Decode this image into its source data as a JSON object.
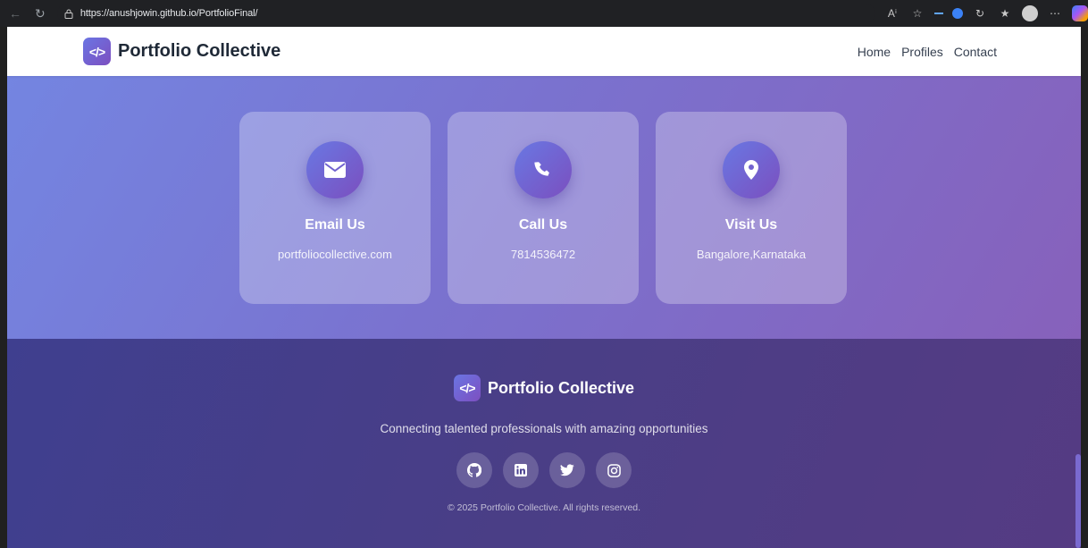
{
  "browser": {
    "url": "https://anushjowin.github.io/PortfolioFinal/"
  },
  "navbar": {
    "brand": "Portfolio Collective",
    "links": [
      "Home",
      "Profiles",
      "Contact"
    ]
  },
  "contact": {
    "cards": [
      {
        "title": "Email Us",
        "value": "portfoliocollective.com",
        "icon": "envelope-icon"
      },
      {
        "title": "Call Us",
        "value": "7814536472",
        "icon": "phone-icon"
      },
      {
        "title": "Visit Us",
        "value": "Bangalore,Karnataka",
        "icon": "map-pin-icon"
      }
    ]
  },
  "footer": {
    "brand": "Portfolio Collective",
    "tagline": "Connecting talented professionals with amazing opportunities",
    "socials": [
      "github-icon",
      "linkedin-icon",
      "twitter-icon",
      "instagram-icon"
    ],
    "copyright": "© 2025 Portfolio Collective. All rights reserved."
  },
  "colors": {
    "accent_start": "#6a75e3",
    "accent_end": "#7d4fc0",
    "footer_bg": "#483f88"
  }
}
